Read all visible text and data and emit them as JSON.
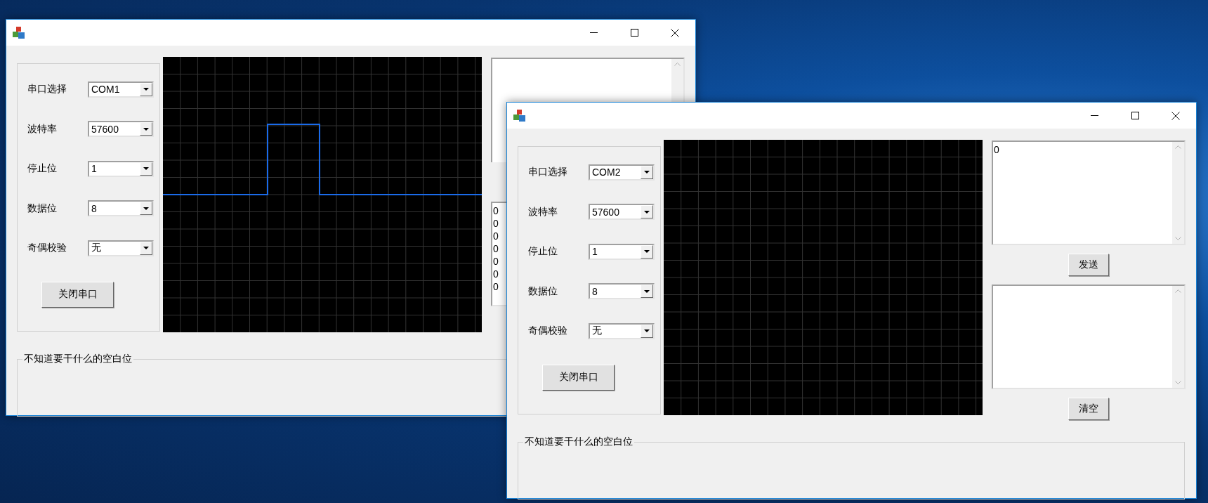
{
  "windows": [
    {
      "settings": [
        {
          "label": "串口选择",
          "value": "COM1"
        },
        {
          "label": "波特率",
          "value": "57600"
        },
        {
          "label": "停止位",
          "value": "1"
        },
        {
          "label": "数据位",
          "value": "8"
        },
        {
          "label": "奇偶校验",
          "value": "无"
        }
      ],
      "port_button": "关闭串口",
      "scope": {
        "trace": true
      },
      "lower_box": {
        "lines": [
          "0",
          "0",
          "0",
          "0",
          "0",
          "0",
          "0"
        ]
      },
      "group_title": "不知道要干什么的空白位"
    },
    {
      "settings": [
        {
          "label": "串口选择",
          "value": "COM2"
        },
        {
          "label": "波特率",
          "value": "57600"
        },
        {
          "label": "停止位",
          "value": "1"
        },
        {
          "label": "数据位",
          "value": "8"
        },
        {
          "label": "奇偶校验",
          "value": "无"
        }
      ],
      "port_button": "关闭串口",
      "scope": {
        "trace": false
      },
      "upper_box": {
        "lines": [
          "0"
        ]
      },
      "send_button": "发送",
      "clear_button": "清空",
      "group_title": "不知道要干什么的空白位"
    }
  ]
}
